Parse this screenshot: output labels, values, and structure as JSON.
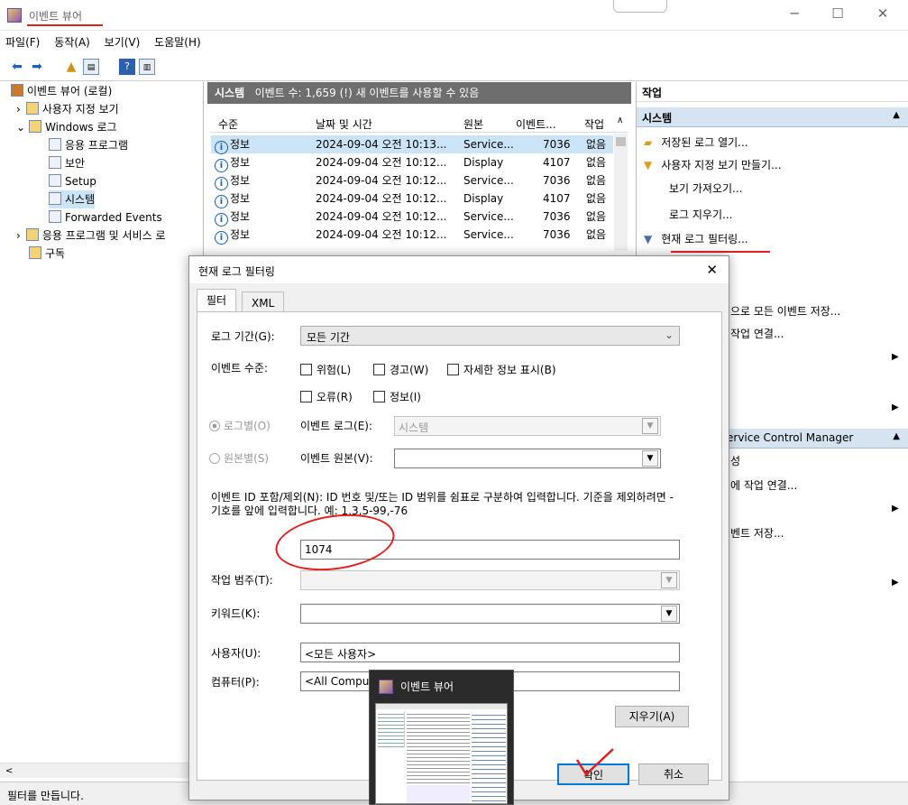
{
  "window": {
    "title": "이벤트 뷰어"
  },
  "menu": [
    "파일(F)",
    "동작(A)",
    "보기(V)",
    "도움말(H)"
  ],
  "tree": {
    "items": [
      {
        "label": "이벤트 뷰어 (로컬)"
      },
      {
        "label": "사용자 지정 보기"
      },
      {
        "label": "Windows 로그"
      },
      {
        "label": "응용 프로그램"
      },
      {
        "label": "보안"
      },
      {
        "label": "Setup"
      },
      {
        "label": "시스템"
      },
      {
        "label": "Forwarded Events"
      },
      {
        "label": "응용 프로그램 및 서비스 로"
      },
      {
        "label": "구독"
      }
    ]
  },
  "center": {
    "title": "시스템",
    "summary": "이벤트 수: 1,659 (!) 새 이벤트를 사용할 수 있음",
    "columns": [
      "수준",
      "날짜 및 시간",
      "원본",
      "이벤트...",
      "작업"
    ],
    "rows": [
      {
        "level": "정보",
        "datetime": "2024-09-04 오전 10:13...",
        "source": "Service...",
        "id": "7036",
        "task": "없음"
      },
      {
        "level": "정보",
        "datetime": "2024-09-04 오전 10:12...",
        "source": "Display",
        "id": "4107",
        "task": "없음"
      },
      {
        "level": "정보",
        "datetime": "2024-09-04 오전 10:12...",
        "source": "Service...",
        "id": "7036",
        "task": "없음"
      },
      {
        "level": "정보",
        "datetime": "2024-09-04 오전 10:12...",
        "source": "Display",
        "id": "4107",
        "task": "없음"
      },
      {
        "level": "정보",
        "datetime": "2024-09-04 오전 10:12...",
        "source": "Service...",
        "id": "7036",
        "task": "없음"
      },
      {
        "level": "정보",
        "datetime": "2024-09-04 오전 10:12...",
        "source": "Service...",
        "id": "7036",
        "task": "없음"
      }
    ]
  },
  "actions": {
    "title": "작업",
    "section1": "시스템",
    "items": [
      "저장된 로그 열기...",
      "사용자 지정 보기 만들기...",
      "보기 가져오기...",
      "로그 지우기...",
      "현재 로그 필터링..."
    ],
    "partial_items": [
      "으로 모든 이벤트 저장...",
      "작업 연결...",
      "ervice Control Manager",
      "성",
      "에 작업 연결...",
      "벤트 저장..."
    ]
  },
  "status": {
    "text": "필터를 만듭니다."
  },
  "dialog": {
    "title": "현재 로그 필터링",
    "tabs": [
      "필터",
      "XML"
    ],
    "log_period_label": "로그 기간(G):",
    "log_period_value": "모든 기간",
    "level_label": "이벤트 수준:",
    "levels": [
      "위험(L)",
      "경고(W)",
      "자세한 정보 표시(B)",
      "오류(R)",
      "정보(I)"
    ],
    "by_log_label": "로그별(O)",
    "event_log_label": "이벤트 로그(E):",
    "event_log_value": "시스템",
    "by_source_label": "원본별(S)",
    "event_source_label": "이벤트 원본(V):",
    "id_desc": "이벤트 ID 포함/제외(N): ID 번호 및/또는 ID 범위를 쉼표로 구분하여 입력합니다. 기준을 제외하려면 - 기호를 앞에 입력합니다. 예: 1,3,5-99,-76",
    "id_value": "1074",
    "task_cat_label": "작업 범주(T):",
    "keyword_label": "키워드(K):",
    "user_label": "사용자(U):",
    "user_value": "<모든 사용자>",
    "computer_label": "컴퓨터(P):",
    "computer_value": "<All Comput",
    "clear_button": "지우기(A)",
    "ok_button": "확인",
    "cancel_button": "취소"
  },
  "taskbar_thumb": {
    "title": "이벤트 뷰어"
  }
}
